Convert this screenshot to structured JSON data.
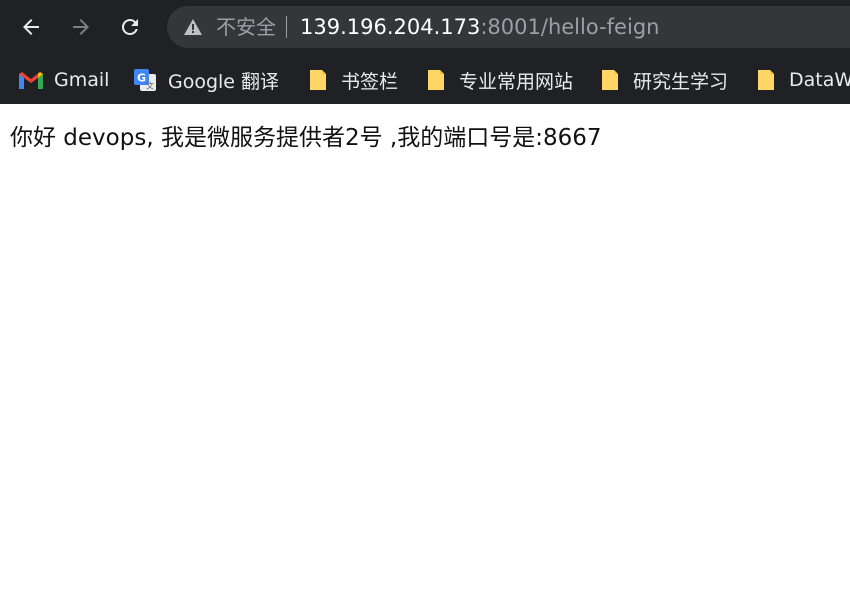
{
  "browser": {
    "nav": {
      "back_icon": "arrow-left-icon",
      "forward_icon": "arrow-right-icon",
      "reload_icon": "reload-icon"
    },
    "omnibox": {
      "security_icon": "warning-triangle-icon",
      "security_label": "不安全",
      "url_host": "139.196.204.173",
      "url_rest": ":8001/hello-feign"
    },
    "bookmarks": [
      {
        "label": "Gmail",
        "icon": "gmail-icon"
      },
      {
        "label": "Google 翻译",
        "icon": "google-translate-icon"
      },
      {
        "label": "书签栏",
        "icon": "folder-icon"
      },
      {
        "label": "专业常用网站",
        "icon": "folder-icon"
      },
      {
        "label": "研究生学习",
        "icon": "folder-icon"
      },
      {
        "label": "DataW",
        "icon": "folder-icon"
      }
    ],
    "colors": {
      "chrome_bg": "#202124",
      "omnibox_bg": "#35363a",
      "folder_yellow": "#fdd663"
    }
  },
  "page": {
    "message": "你好 devops, 我是微服务提供者2号 ,我的端口号是:8667"
  }
}
